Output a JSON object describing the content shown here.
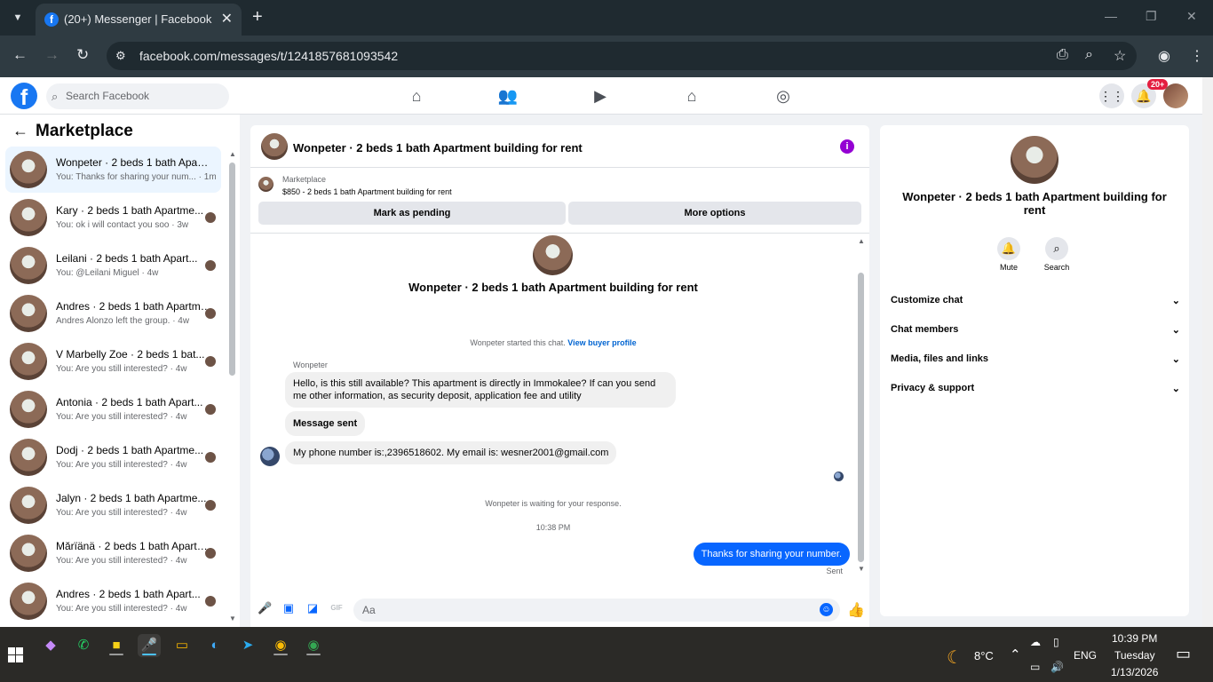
{
  "browser": {
    "tab_title": "(20+) Messenger | Facebook",
    "url": "facebook.com/messages/t/1241857681093542"
  },
  "fb": {
    "search_placeholder": "Search Facebook",
    "notification_badge": "20+",
    "brand_color": "#1877f2"
  },
  "left": {
    "title": "Marketplace",
    "conversations": [
      {
        "name": "Wonpeter · 2 beds 1 bath Apart...",
        "preview": "You: Thanks for sharing your num... · 1m",
        "active": true
      },
      {
        "name": "Kary · 2 beds 1 bath Apartme...",
        "preview": "You: ok i will contact you soo · 3w"
      },
      {
        "name": "Leilani · 2 beds 1 bath Apart...",
        "preview": "You: @Leilani Miguel · 4w"
      },
      {
        "name": "Andres · 2 beds 1 bath Apartme...",
        "preview": "Andres Alonzo left the group. · 4w"
      },
      {
        "name": "V Marbelly Zoe · 2 beds 1 bat...",
        "preview": "You: Are you still interested? · 4w"
      },
      {
        "name": "Antonia · 2 beds 1 bath Apart...",
        "preview": "You: Are you still interested? · 4w"
      },
      {
        "name": "Dodj · 2 beds 1 bath Apartme...",
        "preview": "You: Are you still interested? · 4w"
      },
      {
        "name": "Jalyn · 2 beds 1 bath Apartme...",
        "preview": "You: Are you still interested? · 4w"
      },
      {
        "name": "Mărïänä · 2 beds 1 bath Apartm...",
        "preview": "You: Are you still interested? · 4w"
      },
      {
        "name": "Andres · 2 beds 1 bath Apart...",
        "preview": "You: Are you still interested? · 4w"
      }
    ]
  },
  "chat": {
    "title": "Wonpeter · 2 beds 1 bath Apartment building for rent",
    "marketplace_label": "Marketplace",
    "listing": "$850 - 2 beds 1 bath Apartment building for rent",
    "mark_pending": "Mark as pending",
    "more_options": "More options",
    "started": "Wonpeter started this chat.",
    "view_profile": "View buyer profile",
    "sender": "Wonpeter",
    "msg1": "Hello, is this still available? This apartment is directly in Immokalee? If can you send me other information, as security deposit, application fee and utility",
    "msg2": "Message sent",
    "msg3": "My phone number is:,2396518602. My email is: wesner2001@gmail.com",
    "waiting": "Wonpeter is waiting for your response.",
    "time": "10:38 PM",
    "outgoing": "Thanks for sharing your number.",
    "status": "Sent",
    "input_placeholder": "Aa"
  },
  "right": {
    "name": "Wonpeter · 2 beds 1 bath Apartment building for rent",
    "mute": "Mute",
    "search": "Search",
    "sections": [
      "Customize chat",
      "Chat members",
      "Media, files and links",
      "Privacy & support"
    ]
  },
  "taskbar": {
    "weather": "8°C",
    "lang": "ENG",
    "time": "10:39 PM",
    "day": "Tuesday",
    "date": "1/13/2026"
  }
}
